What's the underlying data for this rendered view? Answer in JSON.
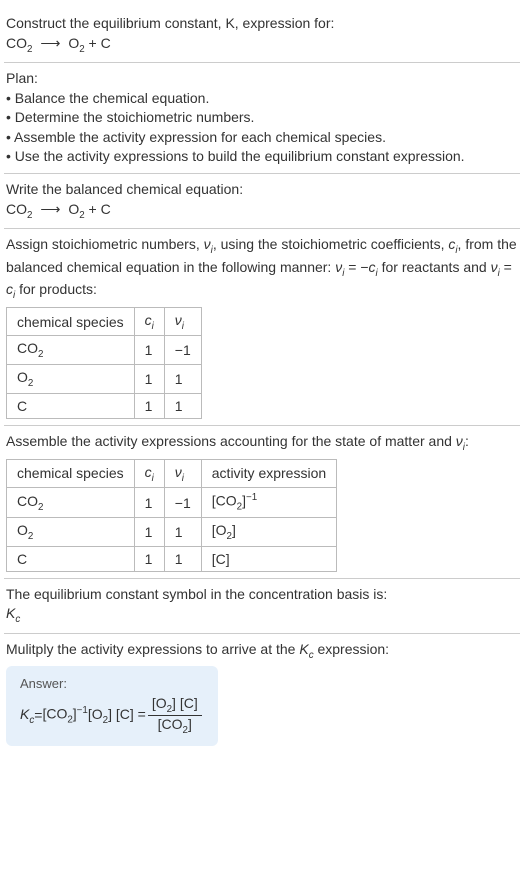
{
  "intro": {
    "title": "Construct the equilibrium constant, K, expression for:",
    "equation_lhs": "CO",
    "equation_lhs_sub": "2",
    "equation_rhs1": "O",
    "equation_rhs1_sub": "2",
    "equation_rhs2": "C",
    "arrow": "⟶",
    "plus": "+"
  },
  "plan": {
    "title": "Plan:",
    "bullets": [
      "• Balance the chemical equation.",
      "• Determine the stoichiometric numbers.",
      "• Assemble the activity expression for each chemical species.",
      "• Use the activity expressions to build the equilibrium constant expression."
    ]
  },
  "balanced": {
    "title": "Write the balanced chemical equation:"
  },
  "stoich": {
    "intro1": "Assign stoichiometric numbers, ",
    "nu": "ν",
    "sub_i": "i",
    "intro2": ", using the stoichiometric coefficients, ",
    "c": "c",
    "intro3": ", from the balanced chemical equation in the following manner: ",
    "eq1": " = −",
    "intro4": " for reactants and ",
    "eq2": " = ",
    "intro5": " for products:",
    "table": {
      "headers": [
        "chemical species",
        "cᵢ",
        "νᵢ"
      ],
      "rows": [
        [
          "CO₂",
          "1",
          "−1"
        ],
        [
          "O₂",
          "1",
          "1"
        ],
        [
          "C",
          "1",
          "1"
        ]
      ]
    }
  },
  "activity": {
    "title": "Assemble the activity expressions accounting for the state of matter and νᵢ:",
    "table": {
      "headers": [
        "chemical species",
        "cᵢ",
        "νᵢ",
        "activity expression"
      ],
      "rows": [
        {
          "species": "CO₂",
          "c": "1",
          "nu": "−1",
          "expr_base": "[CO₂]",
          "expr_sup": "−1"
        },
        {
          "species": "O₂",
          "c": "1",
          "nu": "1",
          "expr_base": "[O₂]",
          "expr_sup": ""
        },
        {
          "species": "C",
          "c": "1",
          "nu": "1",
          "expr_base": "[C]",
          "expr_sup": ""
        }
      ]
    }
  },
  "symbol": {
    "title": "The equilibrium constant symbol in the concentration basis is:",
    "K": "K",
    "sub": "c"
  },
  "multiply": {
    "title1": "Mulitply the activity expressions to arrive at the ",
    "K": "K",
    "sub": "c",
    "title2": " expression:"
  },
  "answer": {
    "label": "Answer:",
    "K": "K",
    "sub": "c",
    "eq": " = ",
    "term1_base": "[CO₂]",
    "term1_sup": "−1",
    "term2": " [O₂] [C] = ",
    "frac_num": "[O₂] [C]",
    "frac_den": "[CO₂]"
  }
}
